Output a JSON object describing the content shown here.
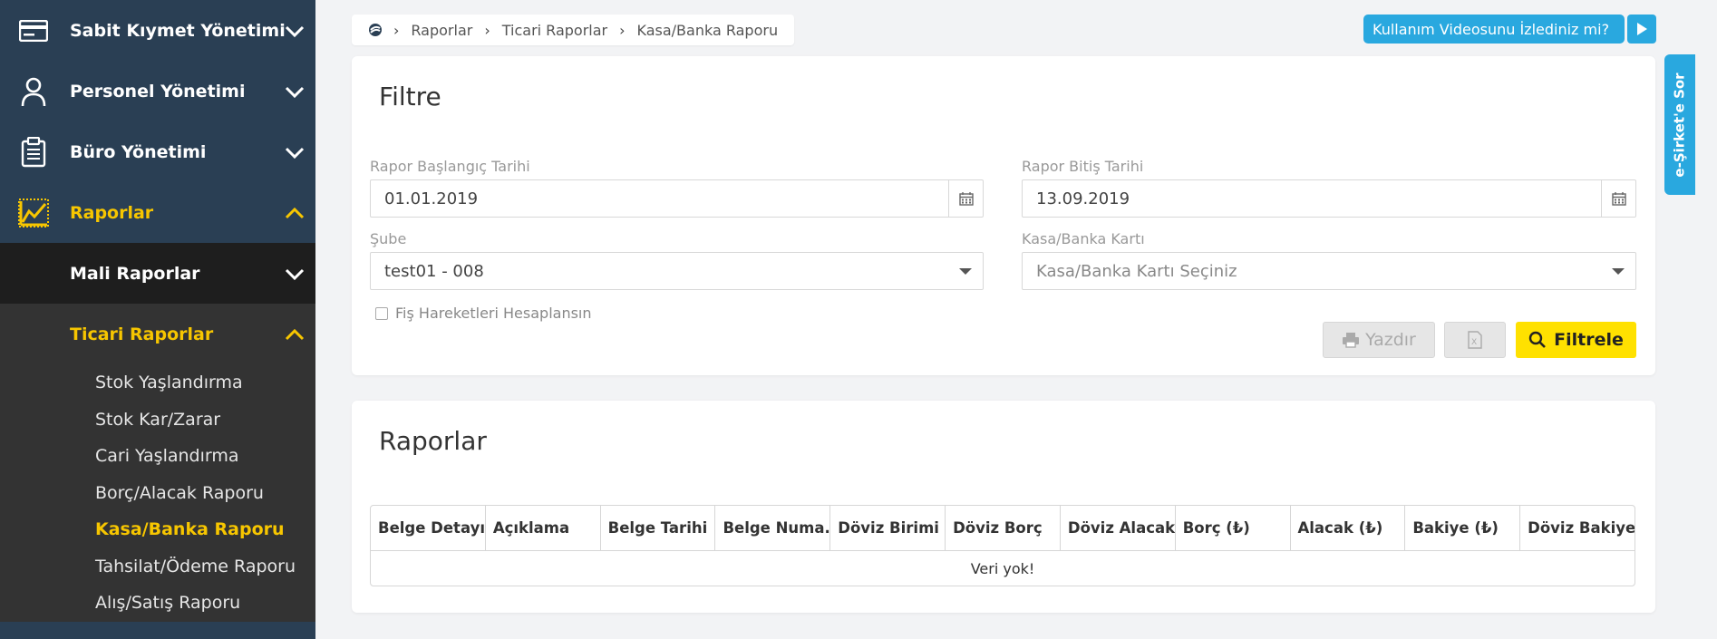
{
  "sidebar": {
    "items": [
      {
        "label": "Sabit Kıymet Yönetimi",
        "icon": "credit-card-icon"
      },
      {
        "label": "Personel Yönetimi",
        "icon": "user-icon"
      },
      {
        "label": "Büro Yönetimi",
        "icon": "clipboard-icon"
      },
      {
        "label": "Raporlar",
        "icon": "chart-icon"
      }
    ],
    "sub_items": [
      {
        "label": "Mali Raporlar"
      },
      {
        "label": "Ticari Raporlar"
      }
    ],
    "leaves": [
      "Stok Yaşlandırma",
      "Stok Kar/Zarar",
      "Cari Yaşlandırma",
      "Borç/Alacak Raporu",
      "Kasa/Banka Raporu",
      "Tahsilat/Ödeme Raporu",
      "Alış/Satış Raporu"
    ]
  },
  "breadcrumb": [
    "Raporlar",
    "Ticari Raporlar",
    "Kasa/Banka Raporu"
  ],
  "video_prompt": "Kullanım Videosunu İzlediniz mi?",
  "help_tab": "e-Şirket'e Sor",
  "filter": {
    "title": "Filtre",
    "start_label": "Rapor Başlangıç Tarihi",
    "start_value": "01.01.2019",
    "end_label": "Rapor Bitiş Tarihi",
    "end_value": "13.09.2019",
    "branch_label": "Şube",
    "branch_value": "test01 - 008",
    "account_label": "Kasa/Banka Kartı",
    "account_placeholder": "Kasa/Banka Kartı Seçiniz",
    "checkbox_label": "Fiş Hareketleri Hesaplansın",
    "print_label": "Yazdır",
    "filter_label": "Filtrele"
  },
  "reports": {
    "title": "Raporlar",
    "columns": [
      "Belge Detayı",
      "Açıklama",
      "Belge Tarihi",
      "Belge Numa...",
      "Döviz Birimi",
      "Döviz Borç",
      "Döviz Alacak",
      "Borç (₺)",
      "Alacak (₺)",
      "Bakiye (₺)",
      "Döviz Bakiye"
    ],
    "empty_text": "Veri yok!"
  },
  "colors": {
    "sidebar_bg": "#2a3f54",
    "accent_yellow": "#f7c600",
    "button_yellow": "#ffe100",
    "info_blue": "#29a8df"
  }
}
